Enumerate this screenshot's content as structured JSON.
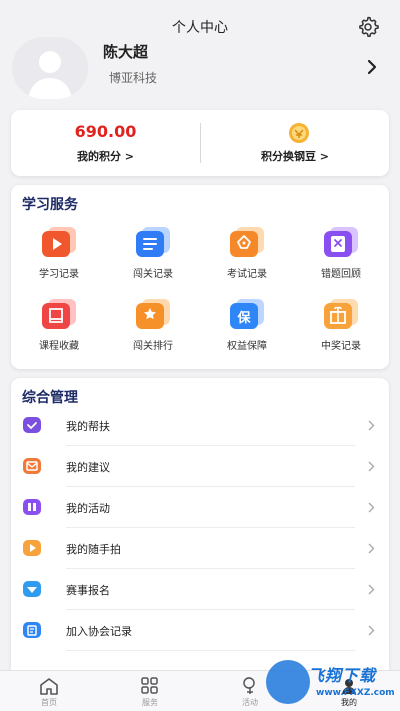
{
  "header": {
    "title": "个人中心",
    "settings_icon": "gear-icon"
  },
  "profile": {
    "name": "陈大超",
    "company": "博亚科技"
  },
  "points": {
    "value": "690.00",
    "label": "我的积分 >",
    "exchange_label": "积分换钢豆 >",
    "value_color": "#e0231f"
  },
  "services": {
    "title": "学习服务",
    "items": [
      {
        "label": "学习记录",
        "icon": "video-play-icon",
        "color": "#f0572d"
      },
      {
        "label": "闯关记录",
        "icon": "document-lines-icon",
        "color": "#2f7cf6"
      },
      {
        "label": "考试记录",
        "icon": "pen-nib-icon",
        "color": "#f5892a"
      },
      {
        "label": "错题回顾",
        "icon": "wrong-answer-icon",
        "color": "#8a4ff0"
      },
      {
        "label": "课程收藏",
        "icon": "bookmark-book-icon",
        "color": "#ef4545"
      },
      {
        "label": "闯关排行",
        "icon": "star-badge-icon",
        "color": "#f6912a"
      },
      {
        "label": "权益保障",
        "icon": "shield-guarantee-icon",
        "color": "#2f86f6"
      },
      {
        "label": "中奖记录",
        "icon": "gift-icon",
        "color": "#f7a23a"
      }
    ]
  },
  "management": {
    "title": "综合管理",
    "items": [
      {
        "label": "我的帮扶",
        "icon": "help-heart-icon",
        "color": "#7b4fe0"
      },
      {
        "label": "我的建议",
        "icon": "suggestion-mail-icon",
        "color": "#f07a3a"
      },
      {
        "label": "我的活动",
        "icon": "activity-icon",
        "color": "#8a4ff0"
      },
      {
        "label": "我的随手拍",
        "icon": "camera-video-icon",
        "color": "#f7a23a"
      },
      {
        "label": "赛事报名",
        "icon": "registration-icon",
        "color": "#2f9cf0"
      },
      {
        "label": "加入协会记录",
        "icon": "join-record-icon",
        "color": "#2f86f6"
      }
    ]
  },
  "bottom_nav": [
    {
      "label": "首页",
      "icon": "home-icon"
    },
    {
      "label": "服务",
      "icon": "grid-icon"
    },
    {
      "label": "活动",
      "icon": "activity-nav-icon"
    },
    {
      "label": "我的",
      "icon": "user-icon"
    }
  ],
  "watermark": {
    "text": "飞翔下载",
    "url": "www.FXXZ.com"
  }
}
